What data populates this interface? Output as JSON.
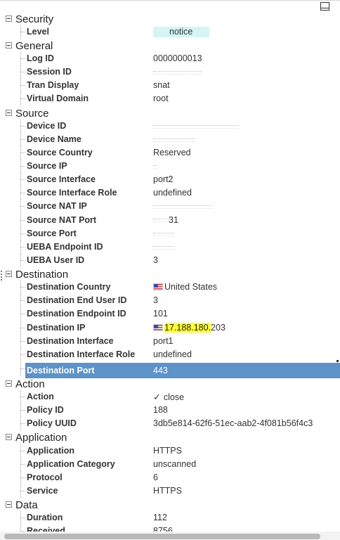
{
  "sections": {
    "security": {
      "title": "Security",
      "rows": [
        {
          "label": "Level",
          "value": "notice"
        }
      ]
    },
    "general": {
      "title": "General",
      "rows": [
        {
          "label": "Log ID",
          "value": "0000000013"
        },
        {
          "label": "Session ID",
          "value": ""
        },
        {
          "label": "Tran Display",
          "value": "snat"
        },
        {
          "label": "Virtual Domain",
          "value": "root"
        }
      ]
    },
    "source": {
      "title": "Source",
      "rows": [
        {
          "label": "Device ID",
          "value": ""
        },
        {
          "label": "Device Name",
          "value": ""
        },
        {
          "label": "Source Country",
          "value": "Reserved"
        },
        {
          "label": "Source IP",
          "value": ""
        },
        {
          "label": "Source Interface",
          "value": "port2"
        },
        {
          "label": "Source Interface Role",
          "value": "undefined"
        },
        {
          "label": "Source NAT IP",
          "value": ""
        },
        {
          "label": "Source NAT Port",
          "value": "31"
        },
        {
          "label": "Source Port",
          "value": ""
        },
        {
          "label": "UEBA Endpoint ID",
          "value": ""
        },
        {
          "label": "UEBA User ID",
          "value": "3"
        }
      ]
    },
    "destination": {
      "title": "Destination",
      "rows": [
        {
          "label": "Destination Country",
          "value": "United States"
        },
        {
          "label": "Destination End User ID",
          "value": "3"
        },
        {
          "label": "Destination Endpoint ID",
          "value": "101"
        },
        {
          "label": "Destination IP",
          "value_highlight": "17.188.180.",
          "value_rest": "203"
        },
        {
          "label": "Destination Interface",
          "value": "port1"
        },
        {
          "label": "Destination Interface Role",
          "value": "undefined"
        },
        {
          "label": "Destination Port",
          "value": "443"
        }
      ]
    },
    "action": {
      "title": "Action",
      "rows": [
        {
          "label": "Action",
          "value": "close"
        },
        {
          "label": "Policy ID",
          "value": "188"
        },
        {
          "label": "Policy UUID",
          "value": "3db5e814-62f6-51ec-aab2-4f081b56f4c3"
        }
      ]
    },
    "application": {
      "title": "Application",
      "rows": [
        {
          "label": "Application",
          "value": "HTTPS"
        },
        {
          "label": "Application Category",
          "value": "unscanned"
        },
        {
          "label": "Protocol",
          "value": "6"
        },
        {
          "label": "Service",
          "value": "HTTPS"
        }
      ]
    },
    "data": {
      "title": "Data",
      "rows": [
        {
          "label": "Duration",
          "value": "112"
        },
        {
          "label": "Received",
          "value": "8756"
        }
      ]
    }
  },
  "colors": {
    "selected_row": "#5d93c7",
    "level_badge": "#d4f4f6",
    "highlight": "#ffff33"
  },
  "icons": {
    "maximize": "maximize-icon",
    "collapse": "collapse-icon",
    "flag": "us-flag-icon",
    "check": "checkmark-icon"
  }
}
